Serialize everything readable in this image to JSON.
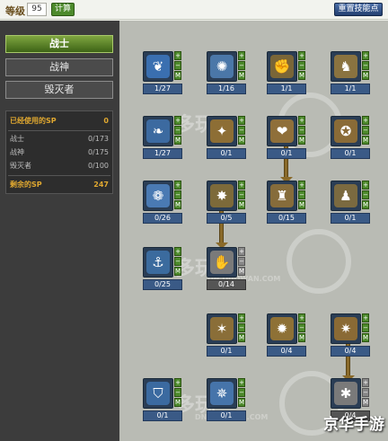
{
  "topbar": {
    "level_label": "等级",
    "level_value": "95",
    "calc_label": "计算",
    "reset_label": "重置技能点"
  },
  "sidebar": {
    "tabs": [
      {
        "label": "战士",
        "active": true
      },
      {
        "label": "战神",
        "active": false
      },
      {
        "label": "毁灭者",
        "active": false
      }
    ],
    "sp": {
      "used_label": "已经使用的SP",
      "used_value": "0",
      "rows": [
        {
          "label": "战士",
          "value": "0/173"
        },
        {
          "label": "战神",
          "value": "0/175"
        },
        {
          "label": "毁灭者",
          "value": "0/100"
        }
      ],
      "remaining_label": "剩余的SP",
      "remaining_value": "247"
    }
  },
  "tree": {
    "watermark": "多玩",
    "watermark_url": "DN.DUOWAN.COM",
    "brand": "京华手游",
    "skills": [
      {
        "icon": "crescent-slash-icon",
        "glyph": "❦",
        "color": "#3a6fb0",
        "level": "1/27"
      },
      {
        "icon": "whirl-icon",
        "glyph": "✺",
        "color": "#4b77a8",
        "level": "1/16"
      },
      {
        "icon": "uppercut-icon",
        "glyph": "✊",
        "color": "#7a6638",
        "level": "1/1"
      },
      {
        "icon": "boot-kick-icon",
        "glyph": "♞",
        "color": "#8a7340",
        "level": "1/1"
      },
      {
        "icon": "feather-dash-icon",
        "glyph": "❧",
        "color": "#3c6aa0",
        "level": "1/27"
      },
      {
        "icon": "flex-warrior-icon",
        "glyph": "✦",
        "color": "#8d6e35",
        "level": "0/1"
      },
      {
        "icon": "heart-strike-icon",
        "glyph": "❤",
        "color": "#8f6f3a",
        "level": "0/1"
      },
      {
        "icon": "fist-charge-icon",
        "glyph": "✪",
        "color": "#8a6b37",
        "level": "0/1"
      },
      {
        "icon": "blade-swirl-icon",
        "glyph": "❁",
        "color": "#4a7ab3",
        "level": "0/26"
      },
      {
        "icon": "leap-attack-icon",
        "glyph": "✸",
        "color": "#7d6a3a",
        "level": "0/5"
      },
      {
        "icon": "armor-icon",
        "glyph": "♜",
        "color": "#866c3b",
        "level": "0/15"
      },
      {
        "icon": "slam-boot-icon",
        "glyph": "♟",
        "color": "#7b6a40",
        "level": "0/1"
      },
      {
        "icon": "anchor-strike-icon",
        "glyph": "⚓",
        "color": "#3b6b9e",
        "level": "0/25"
      },
      {
        "icon": "gauntlet-icon",
        "glyph": "✋",
        "color": "#7a7a7a",
        "level": "0/14"
      },
      {
        "icon": "rising-blade-icon",
        "glyph": "✶",
        "color": "#8a6e38",
        "level": "0/1"
      },
      {
        "icon": "burst-icon",
        "glyph": "✹",
        "color": "#8e7136",
        "level": "0/4"
      },
      {
        "icon": "shockwave-icon",
        "glyph": "✷",
        "color": "#8a6a35",
        "level": "0/4"
      },
      {
        "icon": "shield-icon",
        "glyph": "⛉",
        "color": "#3b6aa0",
        "level": "0/1"
      },
      {
        "icon": "spin-blade-icon",
        "glyph": "✵",
        "color": "#4674aa",
        "level": "0/1"
      },
      {
        "icon": "mace-icon",
        "glyph": "✱",
        "color": "#7a7a7a",
        "level": "0/4"
      }
    ],
    "ctrl_plus": "+",
    "ctrl_minus": "−",
    "ctrl_master": "M"
  }
}
